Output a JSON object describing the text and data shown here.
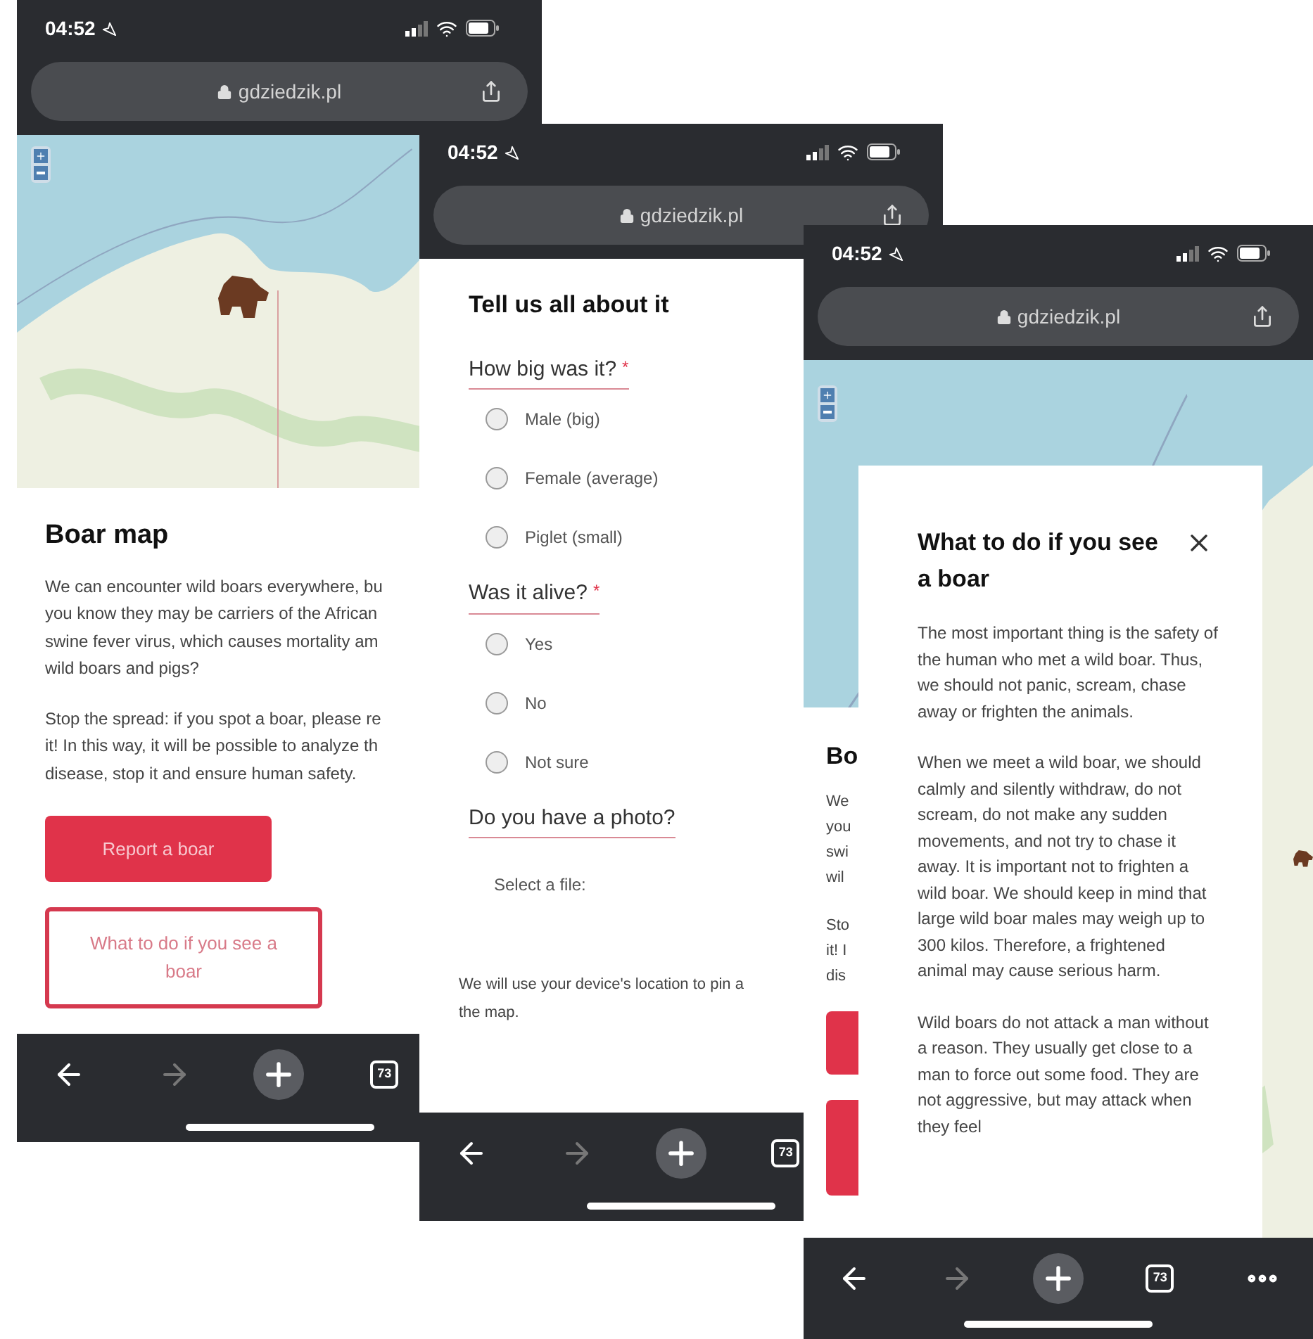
{
  "phone_map": {
    "status_bar": {
      "time": "04:52"
    },
    "address_bar": {
      "url": "gdziedzik.pl"
    },
    "heading": "Boar map",
    "paragraphs": [
      [
        "We can encounter wild boars everywhere, bu",
        "you know they may be carriers of the African",
        "swine fever virus, which causes mortality am",
        "wild boars and pigs?"
      ],
      [
        "Stop the spread: if you spot a boar, please re",
        "it! In this way, it will be possible to analyze th",
        "disease, stop it and ensure human safety."
      ]
    ],
    "buttons": [
      {
        "label": "Report a boar",
        "kind": "filled"
      },
      {
        "label": "What to do if you see a boar",
        "kind": "outline"
      }
    ],
    "toolbar": {
      "tab_count": "73"
    }
  },
  "phone_form": {
    "status_bar": {
      "time": "04:52"
    },
    "address_bar": {
      "url": "gdziedzik.pl"
    },
    "heading": "Tell us all about it",
    "questions": [
      {
        "kind": "radio",
        "label": "How big was it?",
        "required_mark": "*",
        "options": [
          {
            "label": "Male (big)",
            "selected": false
          },
          {
            "label": "Female (average)",
            "selected": false
          },
          {
            "label": "Piglet (small)",
            "selected": false
          }
        ]
      },
      {
        "kind": "radio",
        "label": "Was it alive?",
        "required_mark": "*",
        "options": [
          {
            "label": "Yes",
            "selected": false
          },
          {
            "label": "No",
            "selected": false
          },
          {
            "label": "Not sure",
            "selected": false
          }
        ]
      },
      {
        "kind": "file",
        "label": "Do you have a photo?",
        "file_label": "Select a file:"
      }
    ],
    "note_lines": [
      "We will use your device's location to pin a",
      "the map."
    ],
    "toolbar": {
      "tab_count": "73"
    }
  },
  "phone_modal": {
    "status_bar": {
      "time": "04:52"
    },
    "address_bar": {
      "url": "gdziedzik.pl"
    },
    "background_heading": "Bo",
    "background_lines": [
      [
        "We",
        "you",
        "swi",
        "wil"
      ],
      [
        "Sto",
        "it! I",
        "dis"
      ]
    ],
    "modal": {
      "title": "What to do if you see a boar",
      "paragraphs": [
        "The most important thing is the safety of the human who met a wild boar. Thus, we should not panic, scream, chase away or frighten the animals.",
        "When we meet a wild boar, we should calmly and silently withdraw, do not scream, do not make any sudden movements, and not try to chase it away. It is important not to frighten a wild boar. We should keep in mind that large wild boar males may weigh up to 300 kilos. Therefore, a frightened animal may cause serious harm.",
        "Wild boars do not attack a man without a reason. They usually get close to a man to force out some food. They are not aggressive, but may attack when they feel"
      ]
    },
    "toolbar": {
      "tab_count": "73"
    }
  }
}
